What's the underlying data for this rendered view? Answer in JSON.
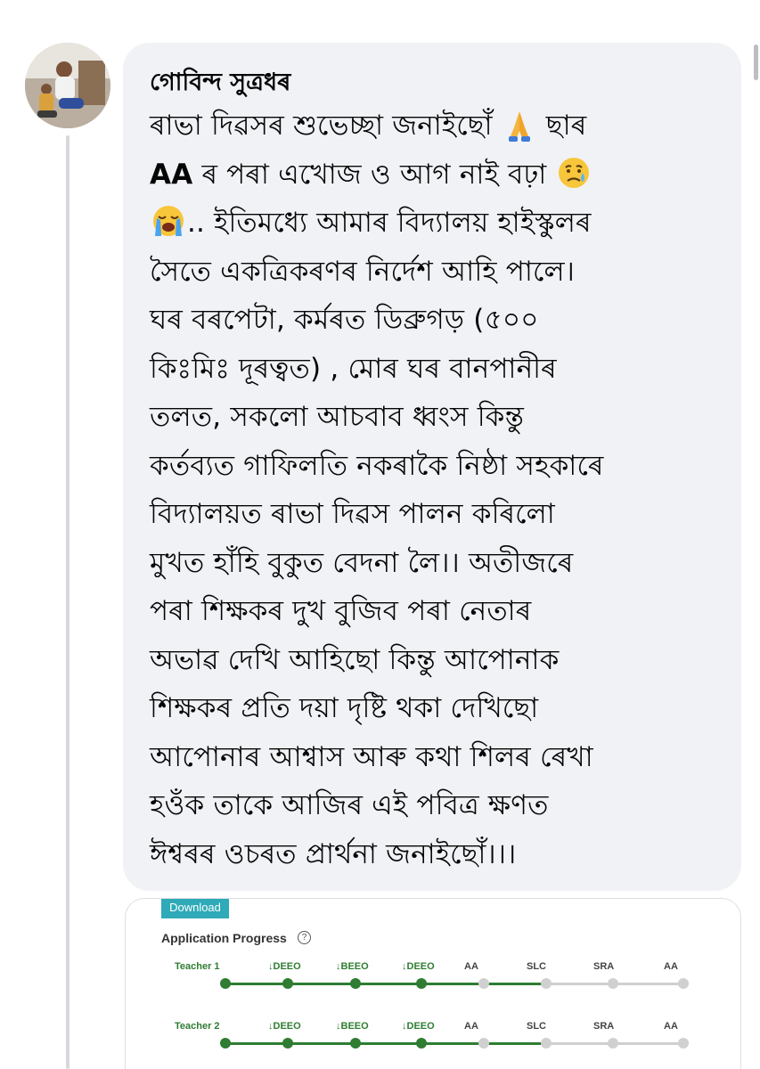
{
  "comment": {
    "author": "গোবিন্দ সুত্ৰধৰ",
    "lines": [
      {
        "pre": "",
        "bold": "",
        "text": "ৰাভা দিৱসৰ শুভেচ্ছা জনাইছোঁ ",
        "emoji": "pray",
        "post": " ছাৰ"
      },
      {
        "pre": "",
        "bold": "AA",
        "text": " ৰ পৰা এখোজ ও আগ নাই বঢ়া ",
        "emoji": "sad",
        "post": ""
      },
      {
        "pre": "cry",
        "bold": "",
        "text": ".. ইতিমধ্যে আমাৰ বিদ্যালয় হাইস্কুলৰ",
        "emoji": "",
        "post": ""
      },
      {
        "pre": "",
        "bold": "",
        "text": "সৈতে একত্ৰিকৰণৰ নিৰ্দেশ আহি পালে।",
        "emoji": "",
        "post": ""
      },
      {
        "pre": "",
        "bold": "",
        "text": "ঘৰ বৰপেটা, কৰ্মৰত ডিব্ৰুগড় (৫০০",
        "emoji": "",
        "post": ""
      },
      {
        "pre": "",
        "bold": "",
        "text": "কিঃমিঃ দূৰত্বত) , মোৰ ঘৰ বানপানীৰ",
        "emoji": "",
        "post": ""
      },
      {
        "pre": "",
        "bold": "",
        "text": "তলত, সকলো আচবাব ধ্বংস কিন্তু",
        "emoji": "",
        "post": ""
      },
      {
        "pre": "",
        "bold": "",
        "text": "কৰ্তব্যত গাফিলতি নকৰাকৈ নিষ্ঠা সহকাৰে",
        "emoji": "",
        "post": ""
      },
      {
        "pre": "",
        "bold": "",
        "text": "বিদ্যালয়ত ৰাভা দিৱস পালন কৰিলো",
        "emoji": "",
        "post": ""
      },
      {
        "pre": "",
        "bold": "",
        "text": "মুখত হাঁহি বুকুত বেদনা লৈ।। অতীজৰে",
        "emoji": "",
        "post": ""
      },
      {
        "pre": "",
        "bold": "",
        "text": "পৰা শিক্ষকৰ দুখ বুজিব পৰা নেতাৰ",
        "emoji": "",
        "post": ""
      },
      {
        "pre": "",
        "bold": "",
        "text": "অভাৱ দেখি আহিছো কিন্তু আপোনাক",
        "emoji": "",
        "post": ""
      },
      {
        "pre": "",
        "bold": "",
        "text": "শিক্ষকৰ প্ৰতি দয়া দৃষ্টি থকা দেখিছো",
        "emoji": "",
        "post": ""
      },
      {
        "pre": "",
        "bold": "",
        "text": "আপোনাৰ আশ্বাস আৰু কথা শিলৰ ৰেখা",
        "emoji": "",
        "post": ""
      },
      {
        "pre": "",
        "bold": "",
        "text": "হওঁক তাকে আজিৰ এই পবিত্ৰ ক্ষণত",
        "emoji": "",
        "post": ""
      },
      {
        "pre": "",
        "bold": "",
        "text": "ঈশ্বৰৰ ওচৰত প্ৰাৰ্থনা জনাইছোঁ।।।",
        "emoji": "",
        "post": ""
      }
    ]
  },
  "attachment": {
    "download_label": "Download",
    "progress_title": "Application Progress",
    "help_symbol": "?",
    "stage_labels": [
      "↓DEEO",
      "↓BEEO",
      "↓DEEO",
      "AA",
      "SLC",
      "SRA",
      "AA"
    ],
    "completed_stages": 3,
    "teachers": [
      {
        "label": "Teacher 1"
      },
      {
        "label": "Teacher 2"
      }
    ],
    "colors": {
      "done": "#2e7d32",
      "pending": "#d0d0d0",
      "download_bg": "#2eaab8"
    }
  },
  "icons": {
    "pray": "folded-hands-emoji",
    "sad": "sad-but-relieved-emoji",
    "cry": "loudly-crying-emoji"
  }
}
